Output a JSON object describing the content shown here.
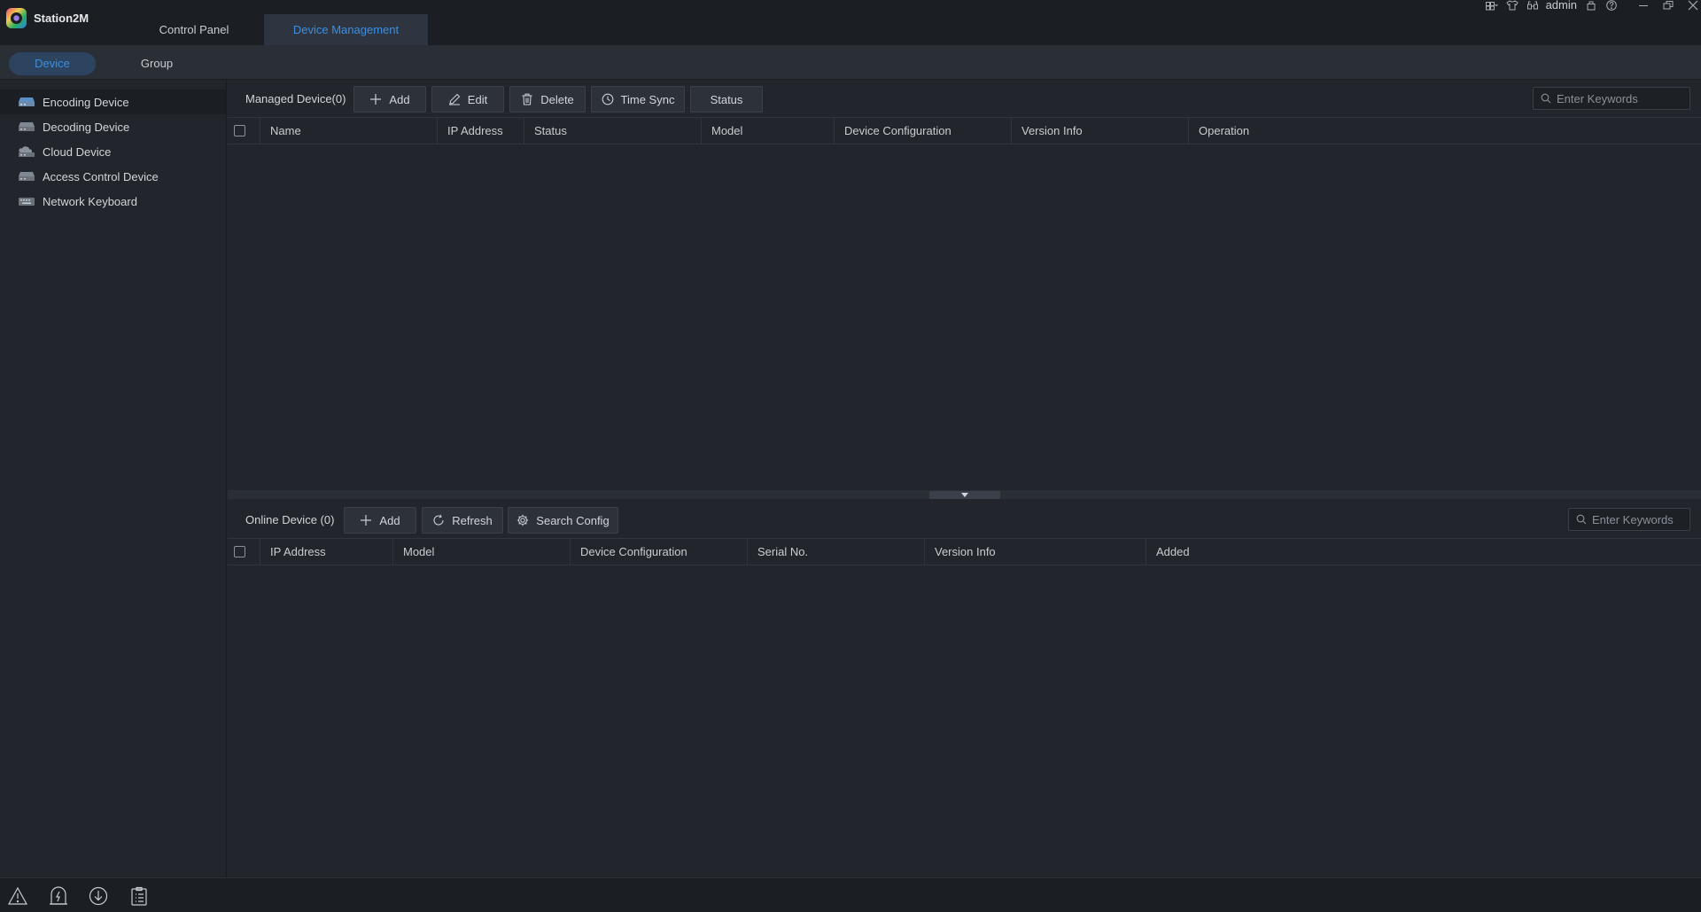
{
  "app": {
    "name": "Station2M",
    "user": "admin"
  },
  "top_tabs": [
    {
      "label": "Control Panel"
    },
    {
      "label": "Device Management"
    }
  ],
  "sub_tabs": [
    {
      "label": "Device"
    },
    {
      "label": "Group"
    }
  ],
  "sidebar": {
    "items": [
      {
        "label": "Encoding Device",
        "icon": "encoding-device-icon"
      },
      {
        "label": "Decoding Device",
        "icon": "decoding-device-icon"
      },
      {
        "label": "Cloud Device",
        "icon": "cloud-device-icon"
      },
      {
        "label": "Access Control Device",
        "icon": "access-control-device-icon"
      },
      {
        "label": "Network Keyboard",
        "icon": "network-keyboard-icon"
      }
    ]
  },
  "managed": {
    "title": "Managed Device(0)",
    "buttons": {
      "add": "Add",
      "edit": "Edit",
      "delete": "Delete",
      "time_sync": "Time Sync",
      "status": "Status"
    },
    "search_placeholder": "Enter Keywords",
    "columns": [
      "Name",
      "IP Address",
      "Status",
      "Model",
      "Device Configuration",
      "Version Info",
      "Operation"
    ],
    "rows": []
  },
  "online": {
    "title": "Online Device (0)",
    "buttons": {
      "add": "Add",
      "refresh": "Refresh",
      "search_config": "Search Config"
    },
    "search_placeholder": "Enter Keywords",
    "columns": [
      "IP Address",
      "Model",
      "Device Configuration",
      "Serial No.",
      "Version Info",
      "Added"
    ],
    "rows": []
  },
  "bottom_icons": [
    "alarm-warning-icon",
    "upgrade-icon",
    "download-icon",
    "task-list-icon"
  ],
  "colors": {
    "accent": "#3c8fe0",
    "background": "#22262c",
    "titlebar": "#1b1e23"
  }
}
